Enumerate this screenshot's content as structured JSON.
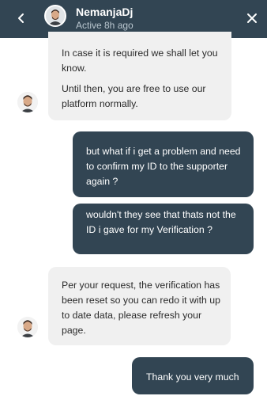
{
  "header": {
    "name": "NemanjaDj",
    "status": "Active 8h ago",
    "back_icon": "chevron-left-icon",
    "close_icon": "close-icon",
    "background": "#324553"
  },
  "messages": [
    {
      "from": "agent",
      "lines": [
        "In case it is required we shall let you know.",
        "Until then, you are free to use our platform normally."
      ]
    },
    {
      "from": "user",
      "text": "but what if i get a problem and need to confirm my ID to the supporter again ?"
    },
    {
      "from": "user",
      "text": "wouldn't they see that thats not the ID i gave for my Verification ?"
    },
    {
      "from": "agent",
      "text": "Per your request, the verification has been reset so you can redo it with up to date data, please refresh your page."
    },
    {
      "from": "user",
      "text": "Thank you very much"
    }
  ],
  "colors": {
    "agent_bubble": "#f0f0f0",
    "user_bubble": "#324553"
  }
}
